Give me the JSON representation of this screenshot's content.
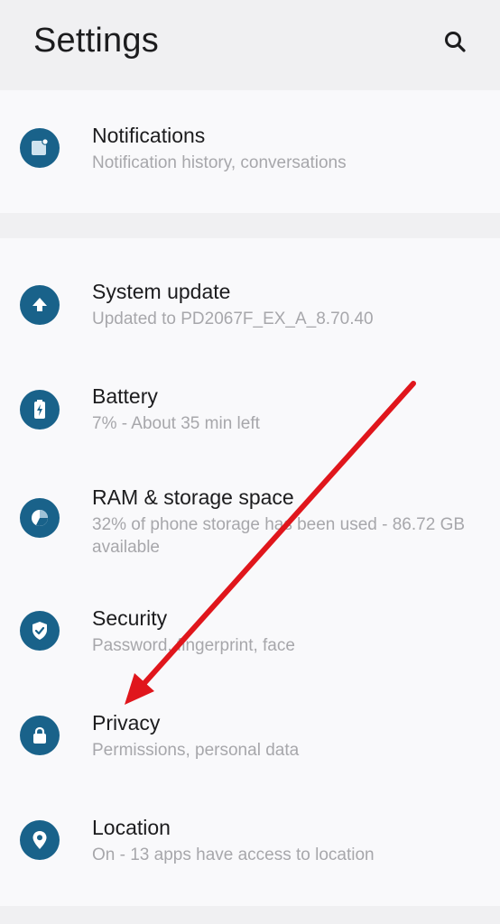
{
  "header": {
    "title": "Settings",
    "search_icon": "search-icon"
  },
  "sections": [
    {
      "items": [
        {
          "key": "notifications",
          "icon": "notification-icon",
          "title": "Notifications",
          "subtitle": "Notification history, conversations"
        }
      ]
    },
    {
      "items": [
        {
          "key": "system-update",
          "icon": "upload-arrow-icon",
          "title": "System update",
          "subtitle": "Updated to PD2067F_EX_A_8.70.40"
        },
        {
          "key": "battery",
          "icon": "battery-charging-icon",
          "title": "Battery",
          "subtitle": "7% - About 35 min left"
        },
        {
          "key": "ram-storage",
          "icon": "storage-pie-icon",
          "title": "RAM & storage space",
          "subtitle": "32% of phone storage has been used - 86.72 GB available"
        },
        {
          "key": "security",
          "icon": "shield-check-icon",
          "title": "Security",
          "subtitle": "Password, fingerprint, face"
        },
        {
          "key": "privacy",
          "icon": "lock-icon",
          "title": "Privacy",
          "subtitle": "Permissions, personal data"
        },
        {
          "key": "location",
          "icon": "location-pin-icon",
          "title": "Location",
          "subtitle": "On - 13 apps have access to location"
        }
      ]
    }
  ],
  "annotation": {
    "type": "arrow",
    "color": "#e0161c",
    "points_to": "Privacy"
  },
  "colors": {
    "icon_bg": "#19628a",
    "card_bg": "#f9f9fb",
    "page_bg": "#f0f0f2",
    "subtitle": "#a7a7ab"
  }
}
